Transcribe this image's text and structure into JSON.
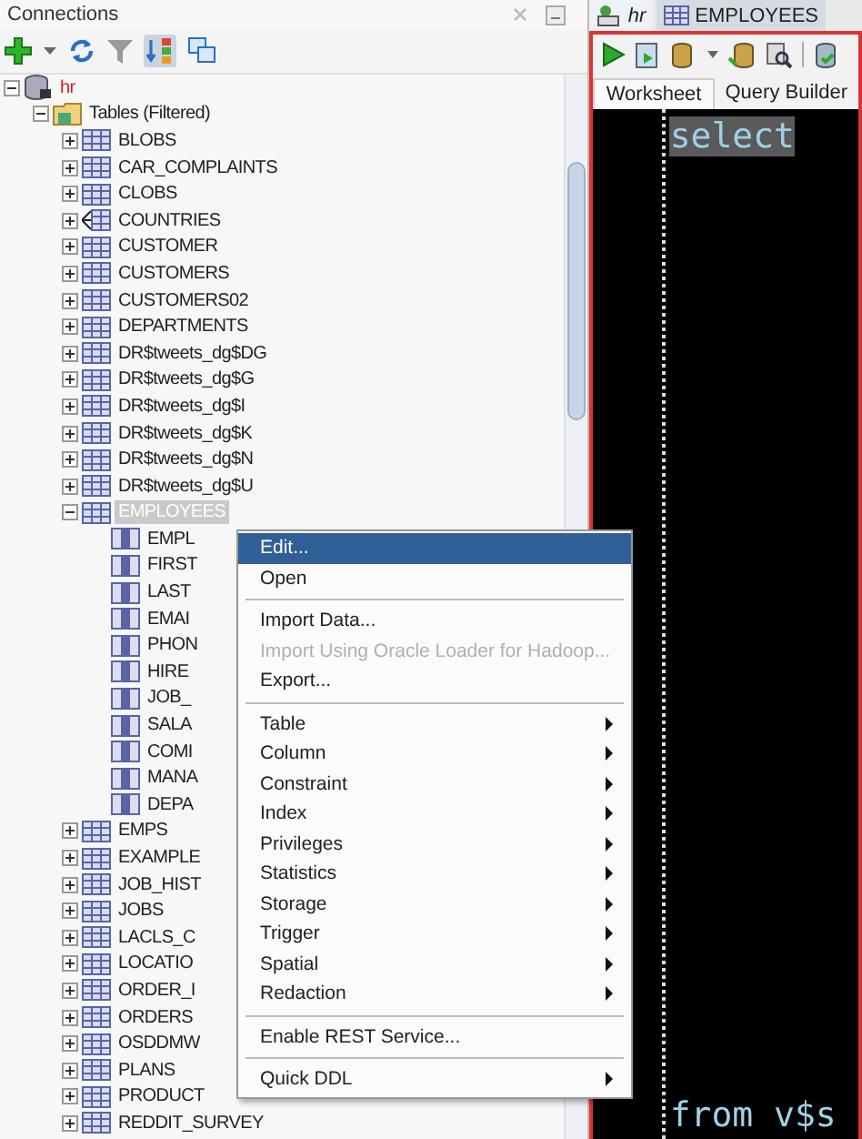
{
  "connections_panel": {
    "title": "Connections",
    "tree": [
      {
        "label": "hr",
        "kind": "connection",
        "expanded": true,
        "selected": false,
        "children": [
          {
            "label": "Tables (Filtered)",
            "kind": "folder",
            "expanded": true,
            "selected": false,
            "children": [
              {
                "label": "BLOBS",
                "kind": "table",
                "expanded": false,
                "selected": false
              },
              {
                "label": "CAR_COMPLAINTS",
                "kind": "table",
                "expanded": false,
                "selected": false
              },
              {
                "label": "CLOBS",
                "kind": "table",
                "expanded": false,
                "selected": false
              },
              {
                "label": "COUNTRIES",
                "kind": "iot",
                "expanded": false,
                "selected": false
              },
              {
                "label": "CUSTOMER",
                "kind": "table",
                "expanded": false,
                "selected": false
              },
              {
                "label": "CUSTOMERS",
                "kind": "table",
                "expanded": false,
                "selected": false
              },
              {
                "label": "CUSTOMERS02",
                "kind": "table",
                "expanded": false,
                "selected": false
              },
              {
                "label": "DEPARTMENTS",
                "kind": "table",
                "expanded": false,
                "selected": false
              },
              {
                "label": "DR$tweets_dg$DG",
                "kind": "table",
                "expanded": false,
                "selected": false
              },
              {
                "label": "DR$tweets_dg$G",
                "kind": "table",
                "expanded": false,
                "selected": false
              },
              {
                "label": "DR$tweets_dg$I",
                "kind": "table",
                "expanded": false,
                "selected": false
              },
              {
                "label": "DR$tweets_dg$K",
                "kind": "table",
                "expanded": false,
                "selected": false
              },
              {
                "label": "DR$tweets_dg$N",
                "kind": "table",
                "expanded": false,
                "selected": false
              },
              {
                "label": "DR$tweets_dg$U",
                "kind": "table",
                "expanded": false,
                "selected": false
              },
              {
                "label": "EMPLOYEES",
                "kind": "table",
                "expanded": true,
                "selected": true,
                "children": [
                  {
                    "label": "EMPL",
                    "kind": "column",
                    "selected": false
                  },
                  {
                    "label": "FIRST",
                    "kind": "column",
                    "selected": false
                  },
                  {
                    "label": "LAST",
                    "kind": "column",
                    "selected": false
                  },
                  {
                    "label": "EMAI",
                    "kind": "column",
                    "selected": false
                  },
                  {
                    "label": "PHON",
                    "kind": "column",
                    "selected": false
                  },
                  {
                    "label": "HIRE",
                    "kind": "column",
                    "selected": false
                  },
                  {
                    "label": "JOB_",
                    "kind": "column",
                    "selected": false
                  },
                  {
                    "label": "SALA",
                    "kind": "column",
                    "selected": false
                  },
                  {
                    "label": "COMI",
                    "kind": "column",
                    "selected": false
                  },
                  {
                    "label": "MANA",
                    "kind": "column",
                    "selected": false
                  },
                  {
                    "label": "DEPA",
                    "kind": "column",
                    "selected": false
                  }
                ]
              },
              {
                "label": "EMPS",
                "kind": "table",
                "expanded": false,
                "selected": false
              },
              {
                "label": "EXAMPLE",
                "kind": "table",
                "expanded": false,
                "selected": false
              },
              {
                "label": "JOB_HIST",
                "kind": "table",
                "expanded": false,
                "selected": false
              },
              {
                "label": "JOBS",
                "kind": "table",
                "expanded": false,
                "selected": false
              },
              {
                "label": "LACLS_C",
                "kind": "table",
                "expanded": false,
                "selected": false
              },
              {
                "label": "LOCATIO",
                "kind": "table",
                "expanded": false,
                "selected": false
              },
              {
                "label": "ORDER_I",
                "kind": "table",
                "expanded": false,
                "selected": false
              },
              {
                "label": "ORDERS",
                "kind": "table",
                "expanded": false,
                "selected": false
              },
              {
                "label": "OSDDMW",
                "kind": "table",
                "expanded": false,
                "selected": false
              },
              {
                "label": "PLANS",
                "kind": "table",
                "expanded": false,
                "selected": false
              },
              {
                "label": "PRODUCT",
                "kind": "table",
                "expanded": false,
                "selected": false
              },
              {
                "label": "REDDIT_SURVEY",
                "kind": "table",
                "expanded": false,
                "selected": false
              }
            ]
          }
        ]
      }
    ]
  },
  "context_menu": [
    {
      "kind": "item",
      "label": "Edit...",
      "selected": true,
      "disabled": false,
      "submenu": false
    },
    {
      "kind": "item",
      "label": "Open",
      "selected": false,
      "disabled": false,
      "submenu": false
    },
    {
      "kind": "separator"
    },
    {
      "kind": "item",
      "label": "Import Data...",
      "selected": false,
      "disabled": false,
      "submenu": false
    },
    {
      "kind": "item",
      "label": "Import Using Oracle Loader for Hadoop...",
      "selected": false,
      "disabled": true,
      "submenu": false
    },
    {
      "kind": "item",
      "label": "Export...",
      "selected": false,
      "disabled": false,
      "submenu": false
    },
    {
      "kind": "separator"
    },
    {
      "kind": "item",
      "label": "Table",
      "selected": false,
      "disabled": false,
      "submenu": true
    },
    {
      "kind": "item",
      "label": "Column",
      "selected": false,
      "disabled": false,
      "submenu": true
    },
    {
      "kind": "item",
      "label": "Constraint",
      "selected": false,
      "disabled": false,
      "submenu": true
    },
    {
      "kind": "item",
      "label": "Index",
      "selected": false,
      "disabled": false,
      "submenu": true
    },
    {
      "kind": "item",
      "label": "Privileges",
      "selected": false,
      "disabled": false,
      "submenu": true
    },
    {
      "kind": "item",
      "label": "Statistics",
      "selected": false,
      "disabled": false,
      "submenu": true
    },
    {
      "kind": "item",
      "label": "Storage",
      "selected": false,
      "disabled": false,
      "submenu": true
    },
    {
      "kind": "item",
      "label": "Trigger",
      "selected": false,
      "disabled": false,
      "submenu": true
    },
    {
      "kind": "item",
      "label": "Spatial",
      "selected": false,
      "disabled": false,
      "submenu": true
    },
    {
      "kind": "item",
      "label": "Redaction",
      "selected": false,
      "disabled": false,
      "submenu": true
    },
    {
      "kind": "separator"
    },
    {
      "kind": "item",
      "label": "Enable REST Service...",
      "selected": false,
      "disabled": false,
      "submenu": false
    },
    {
      "kind": "separator"
    },
    {
      "kind": "item",
      "label": "Quick DDL",
      "selected": false,
      "disabled": false,
      "submenu": true
    }
  ],
  "editor_tabs": [
    {
      "label": "hr",
      "kind": "worksheet",
      "selected": true
    },
    {
      "label": "EMPLOYEES",
      "kind": "table",
      "selected": false
    }
  ],
  "worksheet_tabs": [
    {
      "label": "Worksheet",
      "selected": true
    },
    {
      "label": "Query Builder",
      "selected": false
    }
  ],
  "editor_lines": [
    {
      "text": "select",
      "highlighted": true
    },
    {
      "text": "from v$s",
      "highlighted": false
    }
  ]
}
